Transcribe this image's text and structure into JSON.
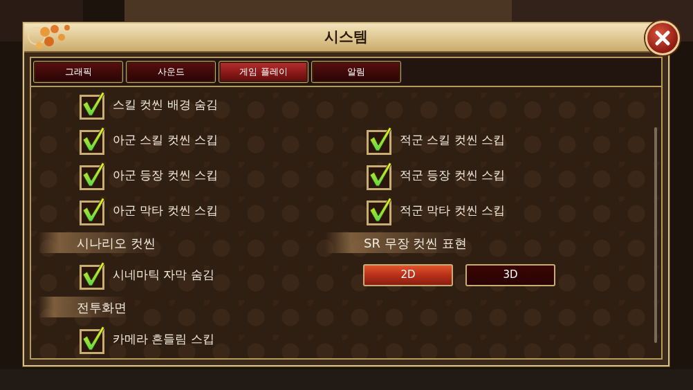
{
  "window": {
    "title": "시스템"
  },
  "tabs": [
    {
      "label": "그래픽",
      "selected": false
    },
    {
      "label": "사운드",
      "selected": false
    },
    {
      "label": "게임 플레이",
      "selected": true
    },
    {
      "label": "알림",
      "selected": false
    }
  ],
  "rows": [
    {
      "left": {
        "kind": "checkbox",
        "label": "스킬 컷씬 배경 숨김",
        "checked": true
      }
    },
    {
      "left": {
        "kind": "checkbox",
        "label": "아군 스킬 컷씬 스킵",
        "checked": true
      },
      "right": {
        "kind": "checkbox",
        "label": "적군 스킬 컷씬 스킵",
        "checked": true
      }
    },
    {
      "left": {
        "kind": "checkbox",
        "label": "아군 등장 컷씬 스킵",
        "checked": true
      },
      "right": {
        "kind": "checkbox",
        "label": "적군 등장 컷씬 스킵",
        "checked": true
      }
    },
    {
      "left": {
        "kind": "checkbox",
        "label": "아군 막타 컷씬 스킵",
        "checked": true
      },
      "right": {
        "kind": "checkbox",
        "label": "적군 막타 컷씬 스킵",
        "checked": true
      }
    },
    {
      "left": {
        "kind": "heading",
        "label": "시나리오 컷씬"
      },
      "right": {
        "kind": "heading",
        "label": "SR 무장 컷씬 표현"
      }
    },
    {
      "left": {
        "kind": "checkbox",
        "label": "시네마틱 자막 숨김",
        "checked": true
      },
      "right": {
        "kind": "choice",
        "options": [
          {
            "label": "2D",
            "selected": true
          },
          {
            "label": "3D",
            "selected": false
          }
        ]
      }
    },
    {
      "left": {
        "kind": "heading",
        "label": "전투화면"
      }
    },
    {
      "left": {
        "kind": "checkbox",
        "label": "카메라 흔들림 스킵",
        "checked": true
      }
    }
  ]
}
